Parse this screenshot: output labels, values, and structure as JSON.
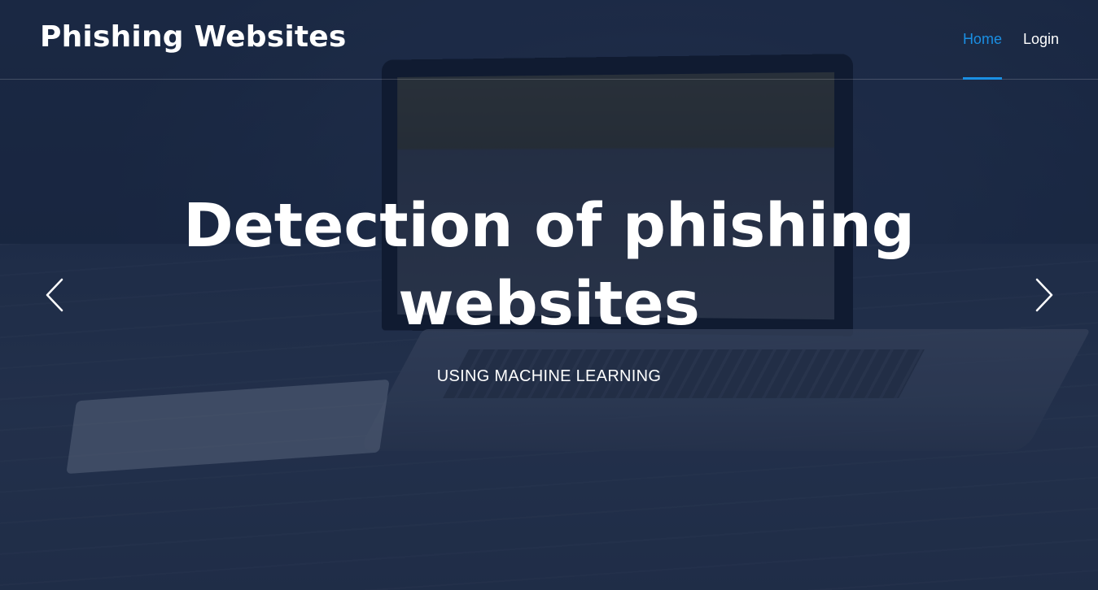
{
  "header": {
    "logo_text": "Phishing Websites",
    "nav": [
      {
        "label": "Home",
        "active": true
      },
      {
        "label": "Login",
        "active": false
      }
    ]
  },
  "hero": {
    "headline_line1": "Detection of phishing",
    "headline_line2": "websites",
    "subheadline": "USING MACHINE LEARNING",
    "prev_icon": "chevron-left-icon",
    "next_icon": "chevron-right-icon"
  },
  "colors": {
    "accent": "#1a8fe3",
    "text": "#ffffff",
    "overlay": "#14203a"
  }
}
